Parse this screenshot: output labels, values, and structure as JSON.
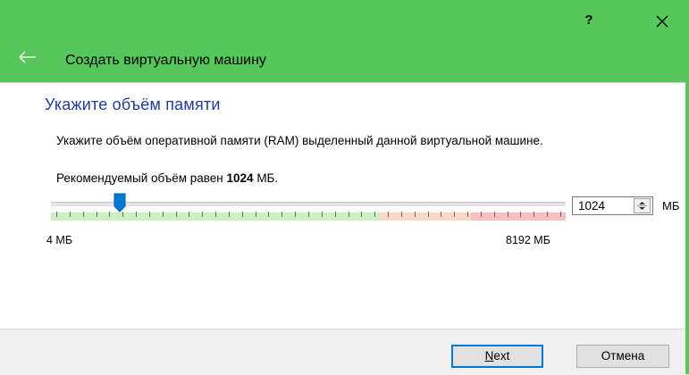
{
  "window": {
    "help_label": "?",
    "wizard_title": "Создать виртуальную машину",
    "accent_color": "#56c75a"
  },
  "page": {
    "heading": "Укажите объём памяти",
    "description": "Укажите объём оперативной памяти (RAM) выделенный данной виртуальной машине.",
    "recommend_prefix": "Рекомендуемый объём равен ",
    "recommend_value": "1024",
    "recommend_suffix": " МБ."
  },
  "memory": {
    "slider_min_label": "4 МБ",
    "slider_max_label": "8192 МБ",
    "slider_min": 4,
    "slider_max": 8192,
    "value": 1024,
    "spinbox_value": "1024",
    "unit": "МБ"
  },
  "buttons": {
    "next_mnemonic": "N",
    "next_rest": "ext",
    "cancel": "Отмена"
  }
}
